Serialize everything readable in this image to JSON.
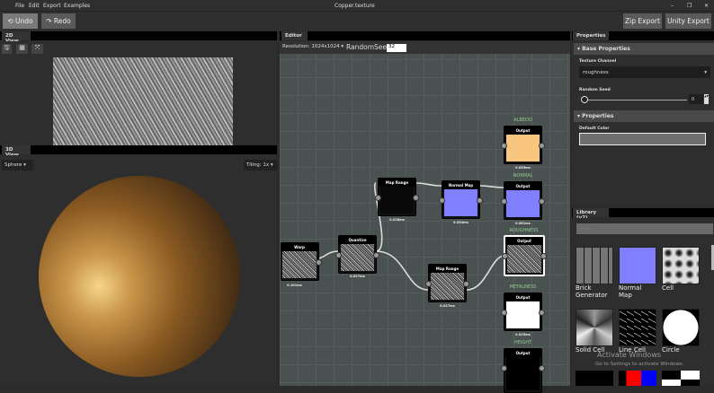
{
  "window": {
    "title": "Copper.texture",
    "menu": [
      "File",
      "Edit",
      "Export",
      "Examples"
    ]
  },
  "toolbar": {
    "undo": "⟲ Undo",
    "redo": "↷ Redo",
    "zip_export": "Zip Export",
    "unity_export": "Unity Export"
  },
  "view2d": {
    "tab": "2D View"
  },
  "view3d": {
    "tab": "3D View",
    "shape": "Sphere",
    "tiling": "Tiling: 1x"
  },
  "editor": {
    "tab": "Editor",
    "resolution": "Resolution: 1024x1024",
    "seed_label": "RandomSeed:",
    "seed_value": "32",
    "nodes": {
      "warp": {
        "title": "Warp",
        "time": "0.101ms"
      },
      "quantize": {
        "title": "Quantize",
        "time": "0.027ms"
      },
      "maprange1": {
        "title": "Map Range",
        "time": "0.028ms"
      },
      "normalmap": {
        "title": "Normal Map",
        "time": "0.054ms"
      },
      "maprange2": {
        "title": "Map Range",
        "time": "0.027ms"
      },
      "albedo": {
        "label": "ALBEDO",
        "title": "Output",
        "time": "0.055ms"
      },
      "normal": {
        "label": "NORMAL",
        "title": "Output",
        "time": "0.061ms"
      },
      "roughness": {
        "label": "ROUGHNESS",
        "title": "Output"
      },
      "metalness": {
        "label": "METALNESS",
        "title": "Output",
        "time": "0.025ms"
      },
      "height": {
        "label": "HEIGHT",
        "title": "Output"
      }
    }
  },
  "properties": {
    "tab": "Properties",
    "base_section": "▾ Base Properties",
    "texture_channel_label": "Texture Channel",
    "texture_channel": "roughness",
    "random_seed_label": "Random Seed",
    "random_seed": "0",
    "props_section": "▾ Properties",
    "default_color_label": "Default Color",
    "default_color": "#6e6e6e"
  },
  "library": {
    "tab": "Library (v2)",
    "filter_placeholder": "Filter...",
    "items": [
      "Brick Generator",
      "Normal Map",
      "Cell",
      "Solid Cell",
      "Line Cell",
      "Circle"
    ]
  },
  "watermark": {
    "line1": "Activate Windows",
    "line2": "Go to Settings to activate Windows."
  }
}
